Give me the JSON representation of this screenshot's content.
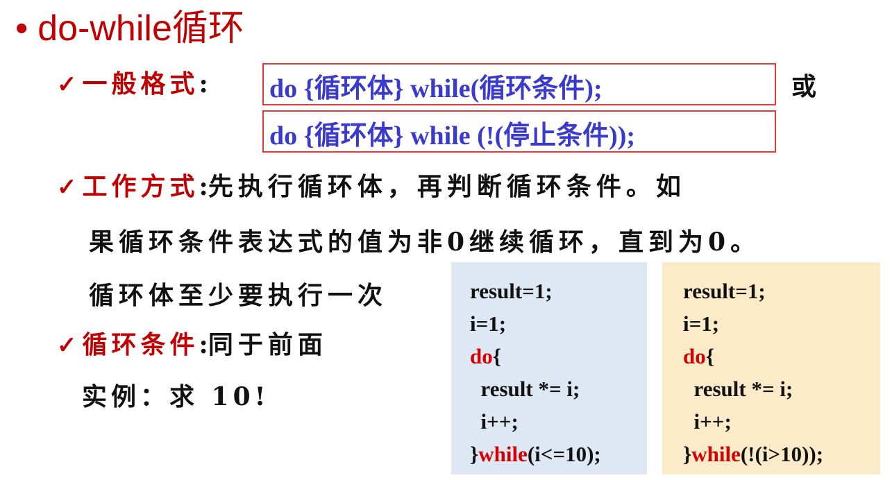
{
  "title": {
    "bullet": "•",
    "text": "do-while循环"
  },
  "sections": {
    "general_format": {
      "check": "✓",
      "label": "一般格式",
      "colon": ":",
      "formats": [
        "do {循环体} while(循环条件);",
        "do {循环体} while (!(停止条件));"
      ],
      "or_text": "或"
    },
    "working_mode": {
      "check": "✓",
      "label": "工作方式",
      "colon": ":",
      "lines": [
        "先执行循环体，再判断循环条件。如",
        "果循环条件表达式的值为非0继续循环，直到为0。",
        "循环体至少要执行一次"
      ]
    },
    "loop_condition": {
      "check": "✓",
      "label": "循环条件",
      "colon": ":",
      "text": "同于前面"
    },
    "example": {
      "text": "实例：求 10!"
    }
  },
  "code_blocks": [
    {
      "background": "#dde8f4",
      "lines": [
        {
          "pre": "result=1;",
          "kw": "",
          "post": ""
        },
        {
          "pre": "i=1;",
          "kw": "",
          "post": ""
        },
        {
          "pre": "",
          "kw": "do",
          "post": "{"
        },
        {
          "pre": "  result *= i;",
          "kw": "",
          "post": ""
        },
        {
          "pre": "  i++;",
          "kw": "",
          "post": ""
        },
        {
          "pre": "}",
          "kw": "while",
          "post": "(i<=10);"
        }
      ]
    },
    {
      "background": "#fbebc8",
      "lines": [
        {
          "pre": "result=1;",
          "kw": "",
          "post": ""
        },
        {
          "pre": "i=1;",
          "kw": "",
          "post": ""
        },
        {
          "pre": "",
          "kw": "do",
          "post": "{"
        },
        {
          "pre": "  result *= i;",
          "kw": "",
          "post": ""
        },
        {
          "pre": "  i++;",
          "kw": "",
          "post": ""
        },
        {
          "pre": "}",
          "kw": "while",
          "post": "(!(i>10));"
        }
      ]
    }
  ],
  "colors": {
    "accent_red": "#c00000",
    "format_blue": "#3a3acc",
    "box_border": "#e03a3a"
  }
}
